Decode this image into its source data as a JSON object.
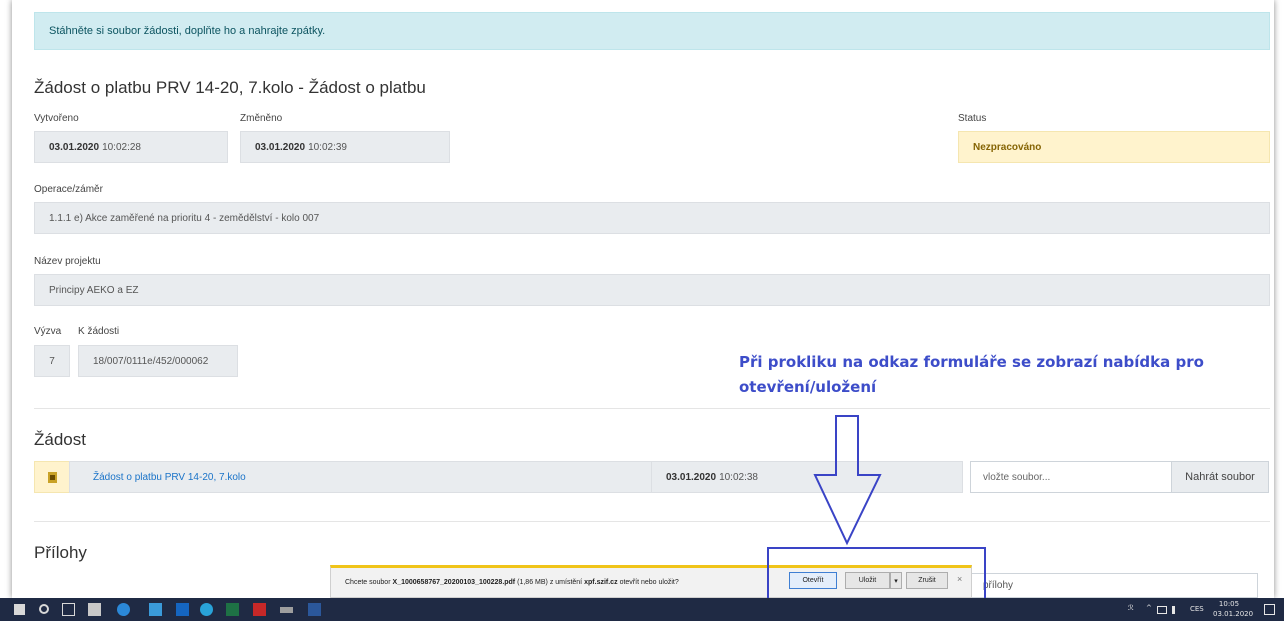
{
  "alert": "Stáhněte si soubor žádosti, doplňte ho a nahrajte zpátky.",
  "title": "Žádost o platbu PRV 14-20, 7.kolo - Žádost o platbu",
  "created": {
    "label": "Vytvořeno",
    "date": "03.01.2020",
    "time": "10:02:28"
  },
  "changed": {
    "label": "Změněno",
    "date": "03.01.2020",
    "time": "10:02:39"
  },
  "status": {
    "label": "Status",
    "value": "Nezpracováno"
  },
  "operation": {
    "label": "Operace/záměr",
    "value": "1.1.1 e) Akce zaměřené na prioritu 4 - zemědělství - kolo 007"
  },
  "project": {
    "label": "Název projektu",
    "value": "Principy AEKO a EZ"
  },
  "call": {
    "label": "Výzva",
    "value": "7"
  },
  "application_ref": {
    "label": "K žádosti",
    "value": "18/007/0111e/452/000062"
  },
  "application_section": {
    "heading": "Žádost",
    "file_link": "Žádost o platbu PRV 14-20, 7.kolo",
    "date": "03.01.2020",
    "time": "10:02:38",
    "input_placeholder": "vložte soubor...",
    "upload_button": "Nahrát soubor"
  },
  "attachments": {
    "heading": "Přílohy",
    "input_partial": "přílohy"
  },
  "annotation": "Při prokliku na odkaz formuláře se zobrazí nabídka pro otevření/uložení",
  "download_bar": {
    "prefix": "Chcete soubor",
    "filename": "X_1000658767_20200103_100228.pdf",
    "size": "(1,86 MB)",
    "mid": "z umístění",
    "host": "xpf.szif.cz",
    "suffix": "otevřít nebo uložit?",
    "open": "Otevřít",
    "save": "Uložit",
    "save_dropdown": "▾",
    "cancel": "Zrušit",
    "close": "×"
  },
  "taskbar": {
    "lang": "CES",
    "time": "10:05",
    "date": "03.01.2020",
    "chevron": "^",
    "person": "ℛ"
  },
  "colors": {
    "alert_bg": "#d1ecf1",
    "status_bg": "#fff3cd",
    "annotation": "#3d4dc9",
    "link": "#1a73c8",
    "taskbar": "#1f2a44"
  }
}
